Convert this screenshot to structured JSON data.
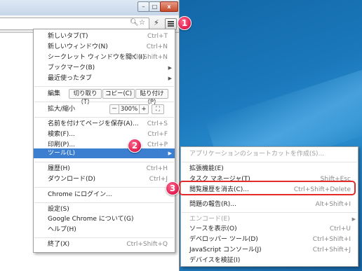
{
  "callouts": [
    "1",
    "2",
    "3"
  ],
  "window": {
    "minimize": "–",
    "maximize": "□",
    "close": "x"
  },
  "toolbar": {
    "zoom_icon": "magnifier-icon",
    "star_icon": "star-icon",
    "ext_icon": "lightning-icon",
    "menu_icon": "hamburger-icon"
  },
  "menu": {
    "new_tab": {
      "label": "新しいタブ(T)",
      "shortcut": "Ctrl+T"
    },
    "new_window": {
      "label": "新しいウィンドウ(N)",
      "shortcut": "Ctrl+N"
    },
    "incognito": {
      "label": "シークレット ウィンドウを開く(I)",
      "shortcut": "Ctrl+Shift+N"
    },
    "bookmarks": {
      "label": "ブックマーク(B)"
    },
    "recent_tabs": {
      "label": "最近使ったタブ"
    },
    "edit": {
      "label": "編集",
      "cut": "切り取り(T)",
      "copy": "コピー(C)",
      "paste": "貼り付け(P)"
    },
    "zoom": {
      "label": "拡大/縮小",
      "minus": "－",
      "value": "300%",
      "plus": "+",
      "fullscreen": "⛶"
    },
    "save_as": {
      "label": "名前を付けてページを保存(A)...",
      "shortcut": "Ctrl+S"
    },
    "find": {
      "label": "検索(F)...",
      "shortcut": "Ctrl+F"
    },
    "print": {
      "label": "印刷(P)...",
      "shortcut": "Ctrl+P"
    },
    "tools": {
      "label": "ツール(L)"
    },
    "history": {
      "label": "履歴(H)",
      "shortcut": "Ctrl+H"
    },
    "downloads": {
      "label": "ダウンロード(D)",
      "shortcut": "Ctrl+J"
    },
    "signin": {
      "label": "Chrome にログイン..."
    },
    "settings": {
      "label": "設定(S)"
    },
    "about": {
      "label": "Google Chrome について(G)"
    },
    "help": {
      "label": "ヘルプ(H)"
    },
    "exit": {
      "label": "終了(X)",
      "shortcut": "Ctrl+Shift+Q"
    }
  },
  "submenu": {
    "create_shortcut": {
      "label": "アプリケーションのショートカットを作成(S)..."
    },
    "extensions": {
      "label": "拡張機能(E)"
    },
    "task_manager": {
      "label": "タスク マネージャ(T)",
      "shortcut": "Shift+Esc"
    },
    "clear_history": {
      "label": "閲覧履歴を消去(C)...",
      "shortcut": "Ctrl+Shift+Delete"
    },
    "report_issue": {
      "label": "問題の報告(R)...",
      "shortcut": "Alt+Shift+I"
    },
    "encoding": {
      "label": "エンコード(E)"
    },
    "view_source": {
      "label": "ソースを表示(O)",
      "shortcut": "Ctrl+U"
    },
    "dev_tools": {
      "label": "デベロッパー ツール(D)",
      "shortcut": "Ctrl+Shift+I"
    },
    "js_console": {
      "label": "JavaScript コンソール(J)",
      "shortcut": "Ctrl+Shift+J"
    },
    "inspect_devices": {
      "label": "デバイスを検証(I)"
    }
  },
  "colors": {
    "highlight": "#3c7fd1",
    "callout": "#e01c4f",
    "annotation_box": "#e32b2b"
  }
}
